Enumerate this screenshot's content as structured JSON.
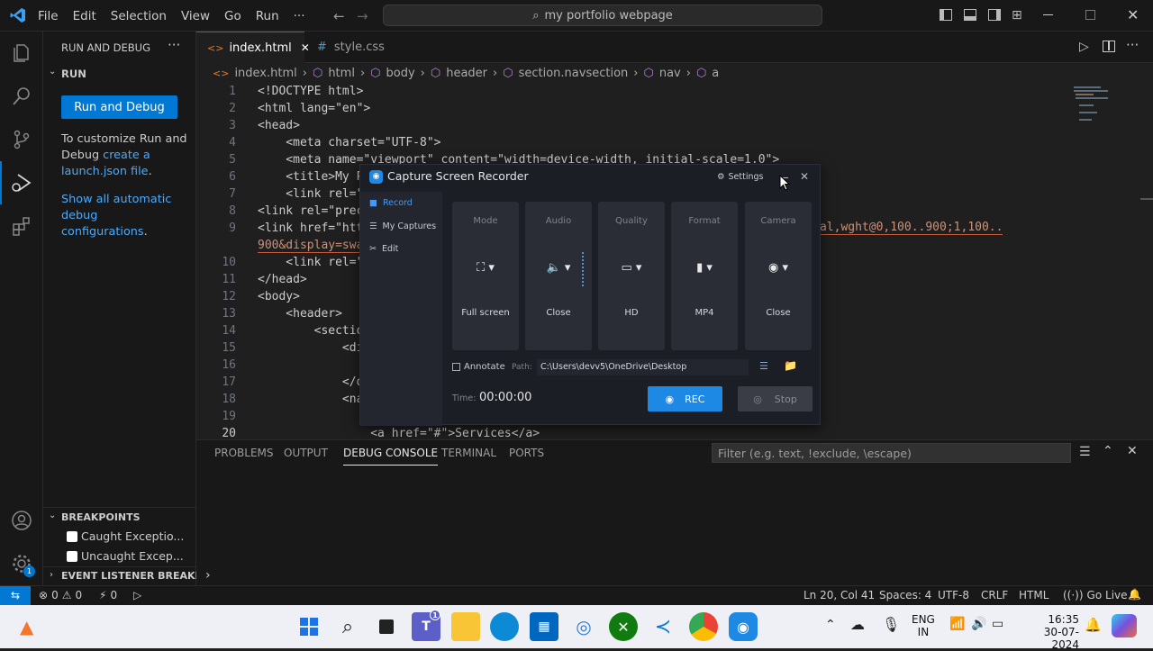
{
  "menu": [
    "File",
    "Edit",
    "Selection",
    "View",
    "Go",
    "Run",
    "···"
  ],
  "command_center": "my portfolio webpage",
  "sidebar": {
    "title": "RUN AND DEBUG",
    "section": "RUN",
    "run_button": "Run and Debug",
    "text1": "To customize Run and Debug ",
    "text1_link": "create a launch.json file",
    "text1_end": ".",
    "link2": "Show all automatic debug configurations",
    "link2_end": ".",
    "breakpoints_title": "BREAKPOINTS",
    "bp1": "Caught Exceptio...",
    "bp2": "Uncaught Excep...",
    "event_listener": "EVENT LISTENER BREAKP..."
  },
  "tabs": [
    {
      "label": "index.html",
      "icon": "<>",
      "active": true
    },
    {
      "label": "style.css",
      "icon": "#",
      "active": false
    }
  ],
  "breadcrumbs": [
    "index.html",
    "html",
    "body",
    "header",
    "section.navsection",
    "nav",
    "a"
  ],
  "code": [
    {
      "n": "1",
      "t": "<!DOCTYPE html>"
    },
    {
      "n": "2",
      "t": "<html lang=\"en\">"
    },
    {
      "n": "3",
      "t": "<head>"
    },
    {
      "n": "4",
      "t": "    <meta charset=\"UTF-8\">"
    },
    {
      "n": "5",
      "t": "    <meta name=\"viewport\" content=\"width=device-width, initial-scale=1.0\">"
    },
    {
      "n": "6",
      "t": "    <title>My P"
    },
    {
      "n": "7",
      "t": "    <link rel=\""
    },
    {
      "n": "8",
      "t": "<link rel=\"prec"
    },
    {
      "n": "9",
      "t": "<link href=\"htt"
    },
    {
      "n": "",
      "t": "900&display=swa"
    },
    {
      "n": "10",
      "t": "    <link rel=\""
    },
    {
      "n": "11",
      "t": "</head>"
    },
    {
      "n": "12",
      "t": "<body>"
    },
    {
      "n": "13",
      "t": "    <header>"
    },
    {
      "n": "14",
      "t": "        <sectio"
    },
    {
      "n": "15",
      "t": "            <di"
    },
    {
      "n": "16",
      "t": ""
    },
    {
      "n": "17",
      "t": "            </d"
    },
    {
      "n": "18",
      "t": "            <na"
    },
    {
      "n": "19",
      "t": ""
    },
    {
      "n": "20",
      "t": "                <a href=\"#\">Services</a>"
    }
  ],
  "code_line9_tail": "rat:ital,wght@0,100..900;1,100..",
  "panel": {
    "tabs": [
      "PROBLEMS",
      "OUTPUT",
      "DEBUG CONSOLE",
      "TERMINAL",
      "PORTS"
    ],
    "active_tab": "DEBUG CONSOLE",
    "filter_placeholder": "Filter (e.g. text, !exclude, \\escape)"
  },
  "status": {
    "errors": "0",
    "warnings": "0",
    "ports": "0",
    "position": "Ln 20, Col 41",
    "spaces": "Spaces: 4",
    "encoding": "UTF-8",
    "eol": "CRLF",
    "language": "HTML",
    "golive": "Go Live"
  },
  "recorder": {
    "title": "Capture Screen Recorder",
    "settings": "Settings",
    "nav": [
      "Record",
      "My Captures",
      "Edit"
    ],
    "cards": [
      {
        "label": "Mode",
        "value": "Full screen",
        "icon": "fullscreen-icon"
      },
      {
        "label": "Audio",
        "value": "Close",
        "icon": "speaker-icon"
      },
      {
        "label": "Quality",
        "value": "HD",
        "icon": "monitor-icon"
      },
      {
        "label": "Format",
        "value": "MP4",
        "icon": "file-icon"
      },
      {
        "label": "Camera",
        "value": "Close",
        "icon": "camera-icon"
      }
    ],
    "annotate": "Annotate",
    "path_label": "Path:",
    "path": "C:\\Users\\devv5\\OneDrive\\Desktop",
    "time_label": "Time:",
    "time": "00:00:00",
    "rec": "REC",
    "stop": "Stop",
    "accent": "#1e88e5"
  },
  "taskbar": {
    "lang1": "ENG",
    "lang2": "IN",
    "time": "16:35",
    "date": "30-07-2024",
    "teams_badge": "1"
  }
}
